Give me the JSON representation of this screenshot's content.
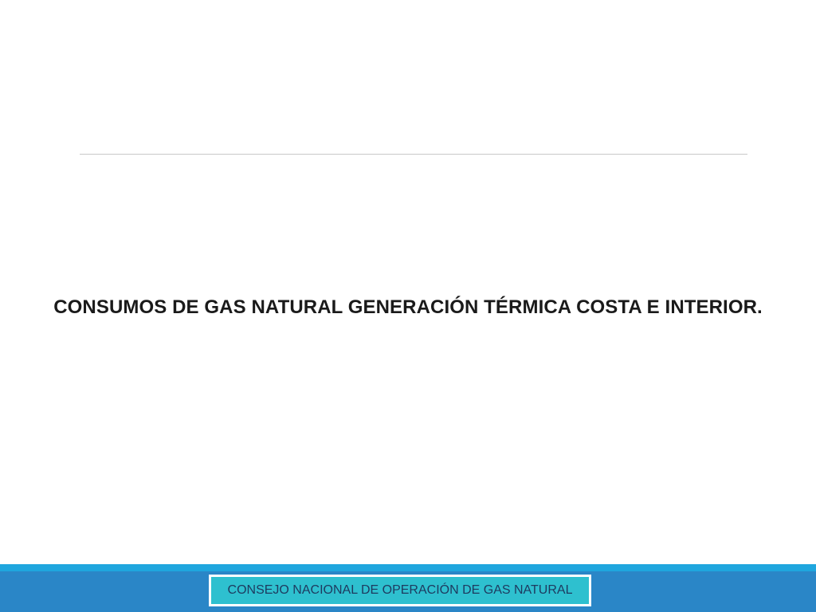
{
  "slide": {
    "title": "CONSUMOS DE GAS NATURAL GENERACIÓN TÉRMICA COSTA E INTERIOR.",
    "footer_label": "CONSEJO NACIONAL DE OPERACIÓN DE GAS NATURAL"
  },
  "colors": {
    "background": "#ffffff",
    "footer_bar": "#2a86c7",
    "footer_stripe": "#1fa6de",
    "footer_box": "#2ec0cf",
    "footer_text": "#1e3a5f",
    "title_text": "#1a1a1a"
  }
}
